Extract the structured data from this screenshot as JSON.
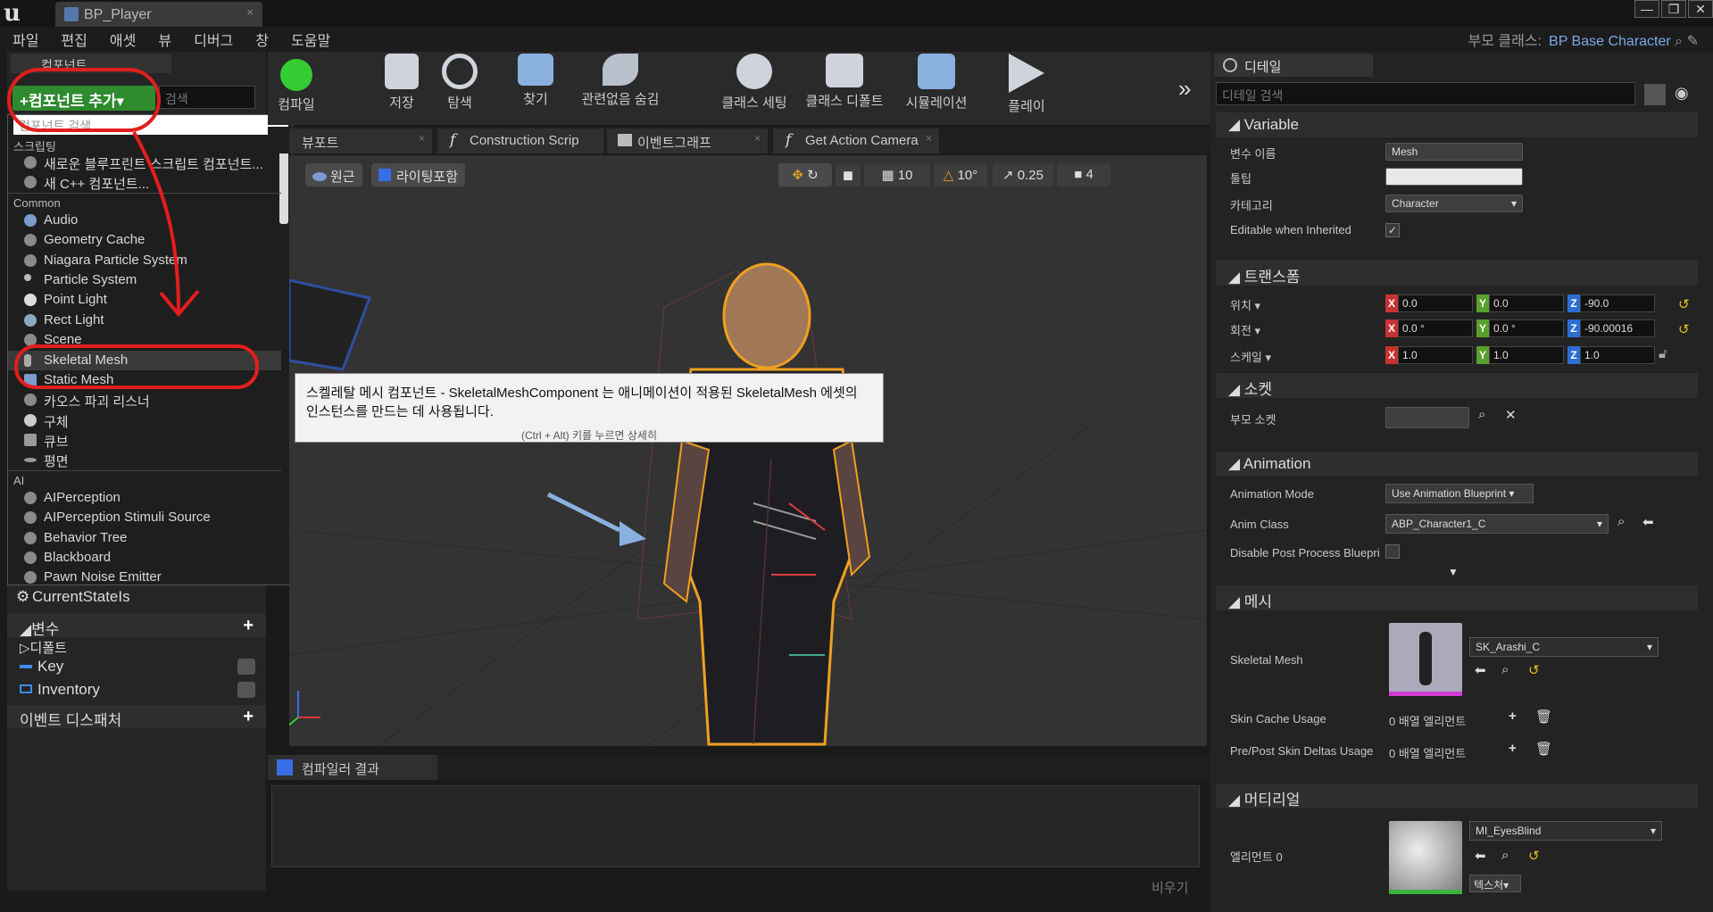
{
  "window": {
    "tab_title": "BP_Player",
    "tab_close": "×",
    "btn_min": "—",
    "btn_max": "❐",
    "btn_close": "✕",
    "logo": "u"
  },
  "menu": [
    "파일",
    "편집",
    "애셋",
    "뷰",
    "디버그",
    "창",
    "도움말"
  ],
  "parent_class": {
    "label": "부모 클래스:",
    "value": "BP Base Character"
  },
  "components": {
    "tab_label": "컴포넌트",
    "add_button": "+컴포넌트 추가▾",
    "search_placeholder": "검색",
    "dropdown_search_placeholder": "컴포넌트 검색",
    "category_script": "스크립팅",
    "script_items": [
      "새로운 블루프린트 스크립트 컴포넌트...",
      "새 C++ 컴포넌트..."
    ],
    "category_common": "Common",
    "common_items": [
      "Audio",
      "Geometry Cache",
      "Niagara Particle System",
      "Particle System",
      "Point Light",
      "Rect Light",
      "Scene",
      "Skeletal Mesh",
      "Static Mesh",
      "카오스 파괴 리스너",
      "구체",
      "큐브",
      "평면"
    ],
    "category_ai": "AI",
    "ai_items": [
      "AIPerception",
      "AIPerception Stimuli Source",
      "Behavior Tree",
      "Blackboard",
      "Pawn Noise Emitter"
    ]
  },
  "my_blueprint": {
    "current_state": "CurrentStateIs",
    "variables_label": "변수",
    "defaults_label": "디폴트",
    "vars": [
      "Key",
      "Inventory"
    ],
    "event_dispatchers": "이벤트 디스패처",
    "plus": "+"
  },
  "toolbar": [
    "컴파일",
    "저장",
    "탐색",
    "찾기",
    "관련없음 숨김",
    "클래스 세팅",
    "클래스 디폴트",
    "시뮬레이션",
    "플레이"
  ],
  "toolbar_more": "»",
  "editor_tabs": [
    "뷰포트",
    "Construction Scrip",
    "이벤트그래프",
    "Get Action Camera"
  ],
  "viewport": {
    "perspective": "원근",
    "lit": "라이팅포함",
    "grid": "10",
    "rot": "10°",
    "scale": "0.25",
    "speed": "4"
  },
  "tooltip": {
    "text": "스켈레탈 메시 컴포넌트 - SkeletalMeshComponent 는 애니메이션이 적용된 SkeletalMesh 에셋의 인스턴스를 만드는 데 사용됩니다.",
    "hint": "(Ctrl + Alt) 키를 누르면 상세히"
  },
  "compiler": {
    "tab": "컴파일러 결과",
    "clear": "비우기"
  },
  "details": {
    "tab": "디테일",
    "search_placeholder": "디테일 검색",
    "variable": {
      "header": "Variable",
      "name_label": "변수 이름",
      "name": "Mesh",
      "tooltip_label": "툴팁",
      "tooltip": "",
      "category_label": "카테고리",
      "category": "Character",
      "editable_label": "Editable when Inherited",
      "check": "✓"
    },
    "transform": {
      "header": "트랜스폼",
      "location_label": "위치 ▾",
      "rotation_label": "회전 ▾",
      "scale_label": "스케일 ▾",
      "location": [
        "0.0",
        "0.0",
        "-90.0"
      ],
      "rotation": [
        "0.0 °",
        "0.0 °",
        "-90.00016"
      ],
      "scale": [
        "1.0",
        "1.0",
        "1.0"
      ]
    },
    "sockets": {
      "header": "소켓",
      "parent_label": "부모 소켓"
    },
    "animation": {
      "header": "Animation",
      "mode_label": "Animation Mode",
      "mode": "Use Animation Blueprint",
      "class_label": "Anim Class",
      "class": "ABP_Character1_C",
      "disable_label": "Disable Post Process Bluepri"
    },
    "mesh": {
      "header": "메시",
      "skeletal_label": "Skeletal Mesh",
      "skeletal": "SK_Arashi_C",
      "skin_cache_label": "Skin Cache Usage",
      "skin_cache": "0 배열 엘리먼트",
      "deltas_label": "Pre/Post Skin Deltas Usage",
      "deltas": "0 배열 엘리먼트"
    },
    "materials": {
      "header": "머티리얼",
      "element_label": "엘리먼트 0",
      "material": "MI_EyesBlind",
      "texture_btn": "텍스처▾"
    }
  }
}
